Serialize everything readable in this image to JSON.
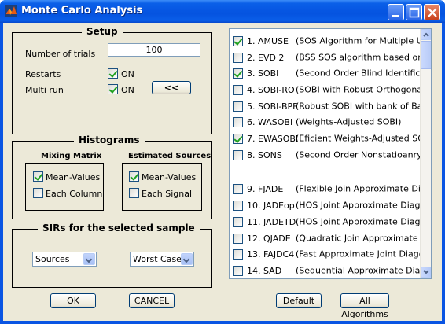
{
  "window": {
    "title": "Monte Carlo Analysis",
    "icons": {
      "app": "matlab-logo-icon",
      "minimize": "minimize-icon",
      "maximize": "maximize-icon",
      "close": "close-icon"
    }
  },
  "setup": {
    "title": "Setup",
    "trials_label": "Number of trials",
    "trials_value": "100",
    "restarts_label": "Restarts",
    "restarts_on": "ON",
    "multirun_label": "Multi run",
    "multirun_on": "ON",
    "expand_button": "<<"
  },
  "histograms": {
    "title": "Histograms",
    "mixing_title": "Mixing Matrix",
    "mixing_mean": "Mean-Values",
    "mixing_each": "Each Column",
    "estimated_title": "Estimated Sources",
    "estimated_mean": "Mean-Values",
    "estimated_each": "Each Signal"
  },
  "sirs": {
    "title": "SIRs for the selected sample",
    "left_select": "Sources",
    "right_select": "Worst Case"
  },
  "algorithms": [
    {
      "label": "1. AMUSE",
      "desc": "(SOS Algorithm for Multiple Unknown Sourc...",
      "checked": true
    },
    {
      "label": "2. EVD 2",
      "desc": "(BSS SOS algorithm based on symmetric E...",
      "checked": false
    },
    {
      "label": "3. SOBI",
      "desc": "(Second Order Blind Identification Algorithm)",
      "checked": true
    },
    {
      "label": "4. SOBI-RO",
      "desc": "(SOBI with Robust Orthogonalization)",
      "checked": false
    },
    {
      "label": "5. SOBI-BPF",
      "desc": "(Robust SOBI with bank of Band-Pass Filte...",
      "checked": false
    },
    {
      "label": "6. WASOBI",
      "desc": "(Weights-Adjusted SOBI)",
      "checked": false
    },
    {
      "label": "7. EWASOBI",
      "desc": "(Eficient Weights-Adjusted SOBI)",
      "checked": true
    },
    {
      "label": "8. SONS",
      "desc": "(Second Order Nonstatioanry Source Sepa...",
      "checked": false
    },
    {
      "label": "9. FJADE",
      "desc": "(Flexible Join Approximate Diagonalization ...",
      "checked": false
    },
    {
      "label": "10. JADEop",
      "desc": "(HOS Joint Approximate Diagonalization of...",
      "checked": false
    },
    {
      "label": "11. JADETD",
      "desc": "(HOS Joint Approximate Diagonalization of...",
      "checked": false
    },
    {
      "label": "12. QJADE",
      "desc": "(Quadratic Join Approximate Diagonalizati...",
      "checked": false
    },
    {
      "label": "13. FAJDC4",
      "desc": "(Fast Approximate Joint Diagonalization of...",
      "checked": false
    },
    {
      "label": "14. SAD",
      "desc": "(Sequential Approximate Diagonalization)",
      "checked": false
    }
  ],
  "buttons": {
    "ok": "OK",
    "cancel": "CANCEL",
    "default": "Default",
    "all_algorithms": "All Algorithms"
  }
}
